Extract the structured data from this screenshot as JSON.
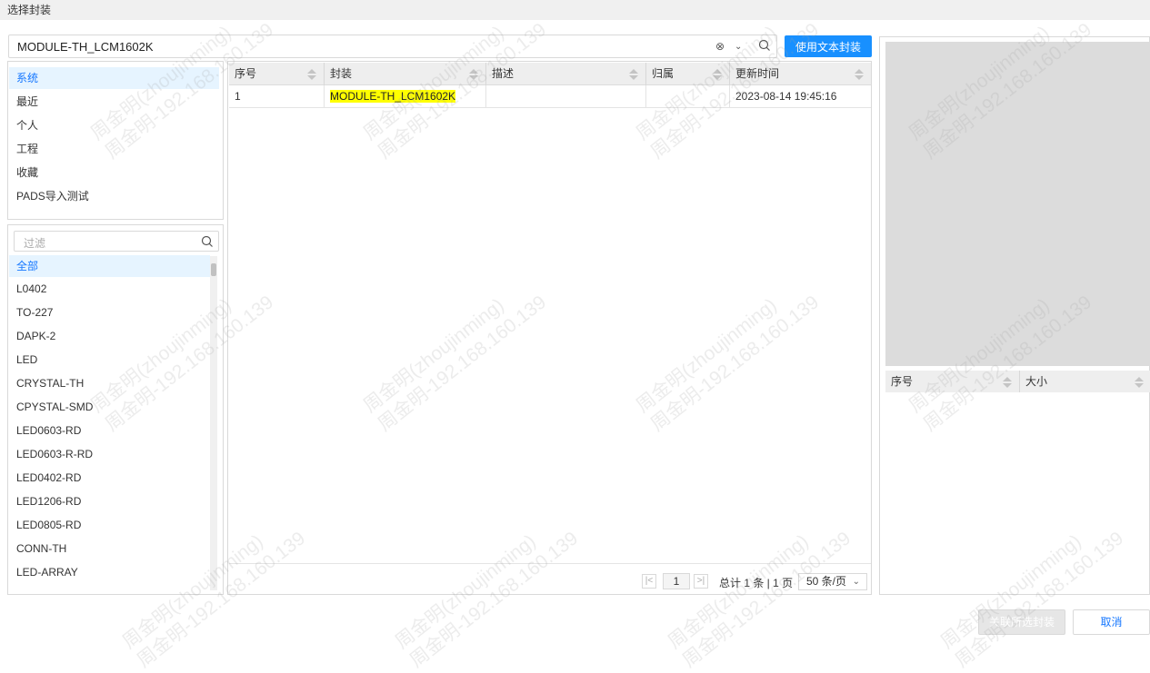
{
  "window": {
    "title": "选择封装"
  },
  "search": {
    "value": "MODULE-TH_LCM1602K",
    "use_text_button": "使用文本封装"
  },
  "categories": [
    "系统",
    "最近",
    "个人",
    "工程",
    "收藏",
    "PADS导入测试"
  ],
  "filter": {
    "placeholder": "过滤"
  },
  "libraries": [
    "全部",
    "L0402",
    "TO-227",
    "DAPK-2",
    "LED",
    "CRYSTAL-TH",
    "CPYSTAL-SMD",
    "LED0603-RD",
    "LED0603-R-RD",
    "LED0402-RD",
    "LED1206-RD",
    "LED0805-RD",
    "CONN-TH",
    "LED-ARRAY"
  ],
  "table": {
    "columns": [
      "序号",
      "封装",
      "描述",
      "归属",
      "更新时间"
    ],
    "rows": [
      {
        "index": "1",
        "footprint": "MODULE-TH_LCM1602K",
        "description": "",
        "owner": "",
        "updated": "2023-08-14 19:45:16"
      }
    ]
  },
  "pagination": {
    "current_page": "1",
    "summary": "总计 1 条 | 1 页",
    "page_size": "50 条/页"
  },
  "preview": {
    "columns": [
      "序号",
      "大小"
    ]
  },
  "footer": {
    "associate_button": "关联所选封装",
    "cancel_button": "取消"
  },
  "watermark": {
    "line1": "周金明(zhoujinming)",
    "line2": "周金明-192.168.160.139"
  },
  "colors": {
    "primary": "#1890ff",
    "highlight": "#ffff00",
    "selected_bg": "#e6f4ff",
    "preview_bg": "#dcdcdc"
  }
}
